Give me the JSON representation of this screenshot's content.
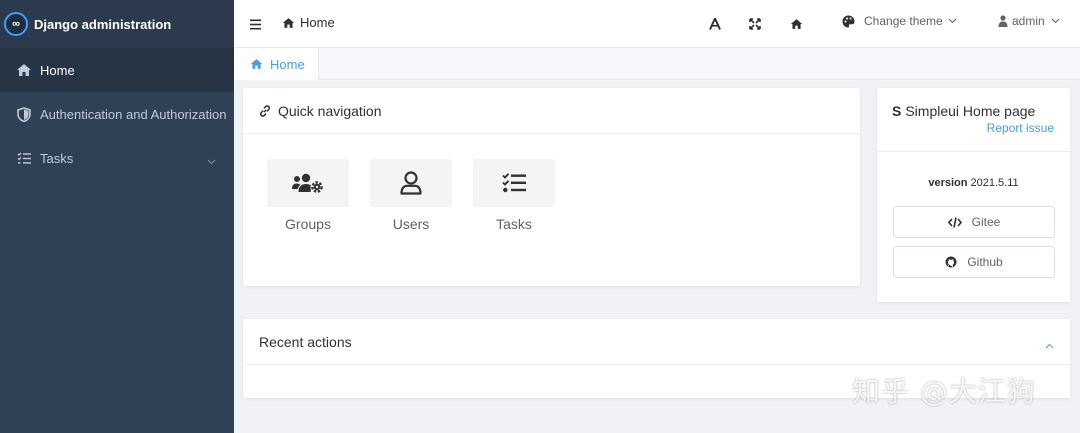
{
  "brand": {
    "title": "Django administration",
    "logo": "∞"
  },
  "sidebar": {
    "items": [
      {
        "label": "Home",
        "icon": "home-icon",
        "active": true
      },
      {
        "label": "Authentication and Authorization",
        "icon": "shield-icon"
      },
      {
        "label": "Tasks",
        "icon": "task-list-icon",
        "expandable": true
      }
    ]
  },
  "header": {
    "breadcrumb": "Home",
    "change_theme": "Change theme",
    "user": "admin"
  },
  "tabs": [
    {
      "label": "Home"
    }
  ],
  "quick_nav": {
    "title": "Quick navigation",
    "items": [
      {
        "label": "Groups",
        "icon": "users-cog-icon"
      },
      {
        "label": "Users",
        "icon": "user-icon"
      },
      {
        "label": "Tasks",
        "icon": "task-list-icon"
      }
    ]
  },
  "simpleui": {
    "title": "Simpleui Home page",
    "report_issue": "Report issue",
    "version_label": "version",
    "version": "2021.5.11",
    "buttons": [
      {
        "label": "Gitee",
        "icon": "code-icon"
      },
      {
        "label": "Github",
        "icon": "github-icon"
      }
    ]
  },
  "recent_actions": {
    "title": "Recent actions"
  },
  "watermark": "知乎 @大江狗",
  "colors": {
    "sidebar": "#304156",
    "accent": "#409eff"
  }
}
